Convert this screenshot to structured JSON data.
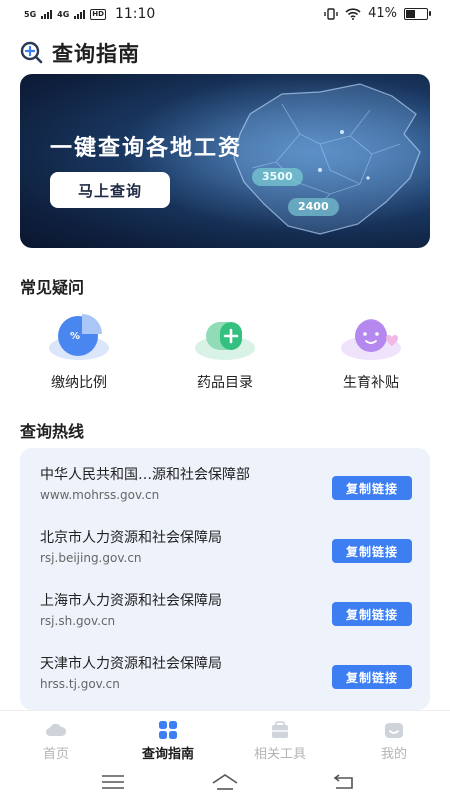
{
  "status_bar": {
    "network_1": "5G",
    "network_2": "4G",
    "hd_label": "HD",
    "time": "11:10",
    "battery_percent": "41%",
    "battery_level": 0.41
  },
  "page": {
    "title": "查询指南",
    "title_icon": "search-plus-icon"
  },
  "banner": {
    "headline": "一键查询各地工资",
    "button_label": "马上查询",
    "badge_1": "3500",
    "badge_2": "2400"
  },
  "faq": {
    "title": "常见疑问",
    "items": [
      {
        "label": "缴纳比例",
        "icon": "pie-chart-icon"
      },
      {
        "label": "药品目录",
        "icon": "medicine-pill-icon"
      },
      {
        "label": "生育补贴",
        "icon": "baby-face-icon"
      }
    ]
  },
  "hotline": {
    "title": "查询热线",
    "copy_label": "复制链接",
    "items": [
      {
        "name": "中华人民共和国…源和社会保障部",
        "url": "www.mohrss.gov.cn"
      },
      {
        "name": "北京市人力资源和社会保障局",
        "url": "rsj.beijing.gov.cn"
      },
      {
        "name": "上海市人力资源和社会保障局",
        "url": "rsj.sh.gov.cn"
      },
      {
        "name": "天津市人力资源和社会保障局",
        "url": "hrss.tj.gov.cn"
      }
    ]
  },
  "tabs": [
    {
      "label": "首页",
      "icon": "cloud-home-icon",
      "active": false
    },
    {
      "label": "查询指南",
      "icon": "grid-guide-icon",
      "active": true
    },
    {
      "label": "相关工具",
      "icon": "toolbox-icon",
      "active": false
    },
    {
      "label": "我的",
      "icon": "profile-icon",
      "active": false
    }
  ],
  "colors": {
    "accent": "#3d7ef2",
    "card_bg": "#eef2fb",
    "banner_dark": "#0e1f3c",
    "tab_inactive": "#b4b4b4"
  }
}
